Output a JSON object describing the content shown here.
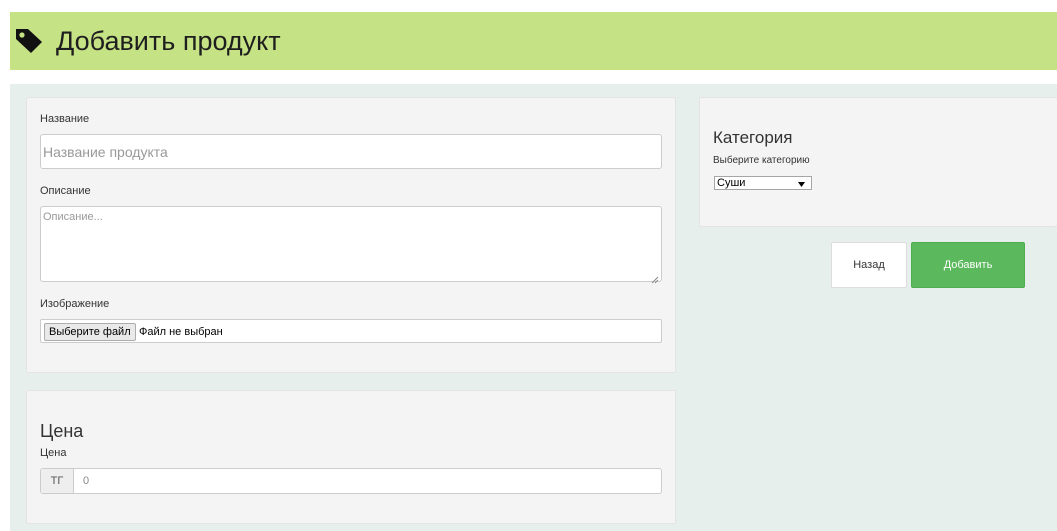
{
  "header": {
    "title": "Добавить продукт",
    "icon": "tag-icon"
  },
  "form": {
    "name_label": "Название",
    "name_placeholder": "Название продукта",
    "description_label": "Описание",
    "description_placeholder": "Описание...",
    "image_label": "Изображение",
    "file_button": "Выберите файл",
    "file_status": "Файл не выбран"
  },
  "price": {
    "title": "Цена",
    "label": "Цена",
    "currency": "ТГ",
    "value": "0"
  },
  "category": {
    "title": "Категория",
    "label": "Выберите категорию",
    "selected": "Суши"
  },
  "actions": {
    "back_label": "Назад",
    "add_label": "Добавить"
  },
  "colors": {
    "header_bg": "#c5e285",
    "content_bg": "#e6efec",
    "add_button": "#5cb85c"
  }
}
